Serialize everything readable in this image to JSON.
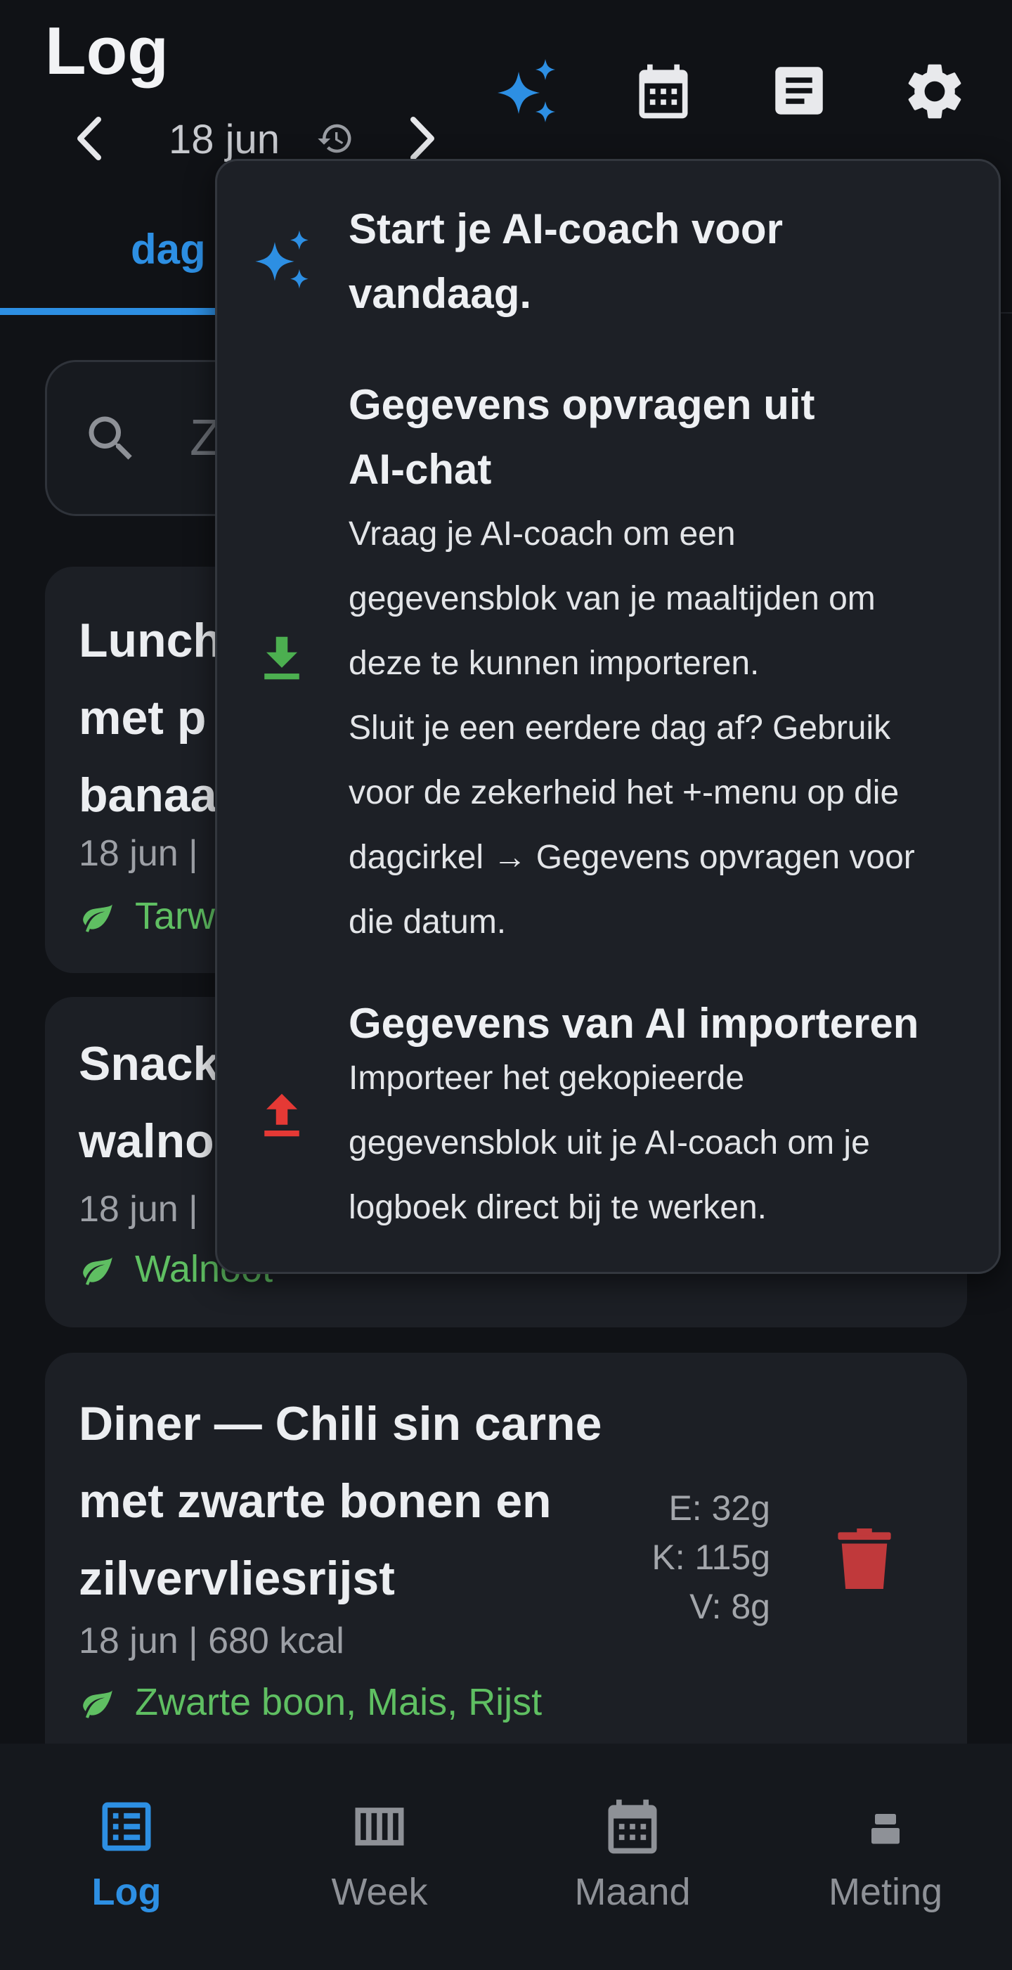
{
  "header": {
    "title": "Log",
    "date": "18 jun"
  },
  "tabs": {
    "active_label": "dag"
  },
  "search": {
    "placeholder_visible": "Z"
  },
  "meals": [
    {
      "title_lines": [
        "Lunch",
        "met p",
        "banaa"
      ],
      "meta": "18 jun |",
      "ingredients": "Tarw"
    },
    {
      "title_lines": [
        "Snack",
        "walno"
      ],
      "meta": "18 jun |",
      "ingredients": "Walnoot"
    },
    {
      "title_lines": [
        "Diner — Chili sin carne",
        "met zwarte bonen en",
        "zilvervliesrijst"
      ],
      "meta": "18 jun | 680 kcal",
      "ingredients": "Zwarte boon, Mais, Rijst",
      "macros": [
        "E: 32g",
        "K: 115g",
        "V: 8g"
      ]
    }
  ],
  "popup": {
    "start_coach": [
      "Start je AI-coach voor",
      "vandaag."
    ],
    "request_title": [
      "Gegevens opvragen uit",
      "AI-chat"
    ],
    "request_body": [
      "Vraag je AI-coach om een",
      "gegevensblok van je maaltijden om",
      "deze te kunnen importeren.",
      "Sluit je een eerdere dag af? Gebruik",
      "voor de zekerheid het +-menu op die",
      "dagcirkel → Gegevens opvragen voor",
      "die datum."
    ],
    "import_title": "Gegevens van AI importeren",
    "import_body": [
      "Importeer het gekopieerde",
      "gegevensblok uit je AI-coach om je",
      "logboek direct bij te werken."
    ]
  },
  "bottom_nav": [
    {
      "label": "Log",
      "active": true
    },
    {
      "label": "Week",
      "active": false
    },
    {
      "label": "Maand",
      "active": false
    },
    {
      "label": "Meting",
      "active": false
    }
  ],
  "colors": {
    "accent": "#2d8fe3",
    "ingredient_green": "#5fbf62",
    "delete_red": "#c0393b",
    "download_green": "#4caf50",
    "upload_red": "#e53935"
  }
}
